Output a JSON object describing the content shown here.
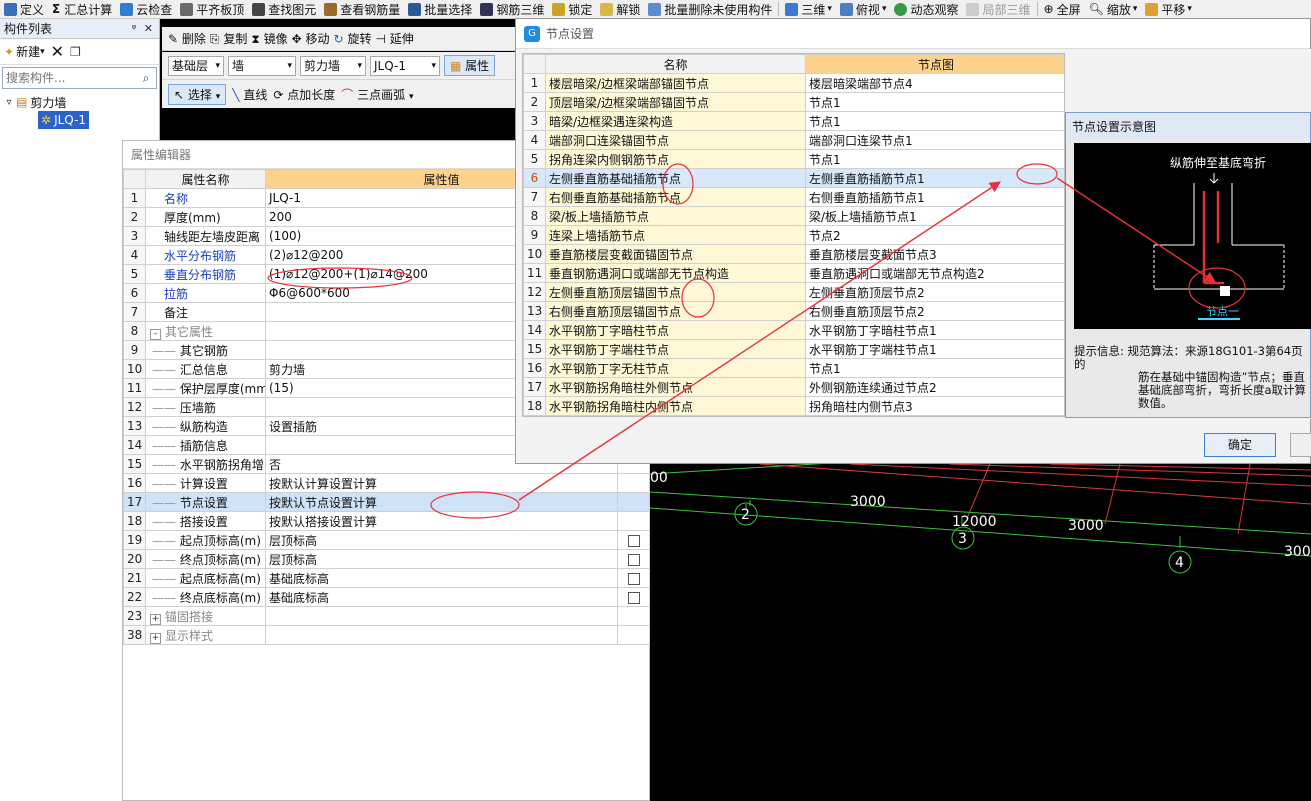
{
  "toolbar_top": {
    "items": [
      "定义",
      "汇总计算",
      "云检查",
      "平齐板顶",
      "查找图元",
      "查看钢筋量",
      "批量选择",
      "钢筋三维",
      "锁定",
      "解锁",
      "批量删除未使用构件",
      "三维",
      "俯视",
      "动态观察",
      "局部三维",
      "全屏",
      "缩放",
      "平移"
    ]
  },
  "left_panel": {
    "title": "构件列表",
    "new_label": "新建",
    "search_placeholder": "搜索构件...",
    "tree_root": "剪力墙",
    "tree_child": "JLQ-1"
  },
  "edit_toolbar": {
    "delete": "删除",
    "copy": "复制",
    "mirror": "镜像",
    "move": "移动",
    "rotate": "旋转",
    "extend": "延伸"
  },
  "filter_bar": {
    "layer": "基础层",
    "type": "墙",
    "subtype": "剪力墙",
    "component": "JLQ-1",
    "property_btn": "属性"
  },
  "draw_bar": {
    "select": "选择",
    "line": "直线",
    "point_length": "点加长度",
    "arc": "三点画弧"
  },
  "property_editor": {
    "title": "属性编辑器",
    "col_name": "属性名称",
    "col_value": "属性值",
    "rows": [
      {
        "n": "1",
        "name": "名称",
        "value": "JLQ-1",
        "blue": true
      },
      {
        "n": "2",
        "name": "厚度(mm)",
        "value": "200"
      },
      {
        "n": "3",
        "name": "轴线距左墙皮距离",
        "value": "(100)"
      },
      {
        "n": "4",
        "name": "水平分布钢筋",
        "value": "(2)⌀12@200",
        "blue": true
      },
      {
        "n": "5",
        "name": "垂直分布钢筋",
        "value": "(1)⌀12@200+(1)⌀14@200",
        "blue": true
      },
      {
        "n": "6",
        "name": "拉筋",
        "value": "Φ6@600*600",
        "blue": true
      },
      {
        "n": "7",
        "name": "备注",
        "value": ""
      },
      {
        "n": "8",
        "name": "其它属性",
        "value": "",
        "group": "-"
      },
      {
        "n": "9",
        "name": "其它钢筋",
        "value": "",
        "child": true
      },
      {
        "n": "10",
        "name": "汇总信息",
        "value": "剪力墙",
        "child": true
      },
      {
        "n": "11",
        "name": "保护层厚度(mm)",
        "value": "(15)",
        "child": true
      },
      {
        "n": "12",
        "name": "压墙筋",
        "value": "",
        "child": true
      },
      {
        "n": "13",
        "name": "纵筋构造",
        "value": "设置插筋",
        "child": true
      },
      {
        "n": "14",
        "name": "插筋信息",
        "value": "",
        "child": true
      },
      {
        "n": "15",
        "name": "水平钢筋拐角增",
        "value": "否",
        "child": true
      },
      {
        "n": "16",
        "name": "计算设置",
        "value": "按默认计算设置计算",
        "child": true
      },
      {
        "n": "17",
        "name": "节点设置",
        "value": "按默认节点设置计算",
        "child": true,
        "selected": true
      },
      {
        "n": "18",
        "name": "搭接设置",
        "value": "按默认搭接设置计算",
        "child": true
      },
      {
        "n": "19",
        "name": "起点顶标高(m)",
        "value": "层顶标高",
        "child": true,
        "check": true
      },
      {
        "n": "20",
        "name": "终点顶标高(m)",
        "value": "层顶标高",
        "child": true,
        "check": true
      },
      {
        "n": "21",
        "name": "起点底标高(m)",
        "value": "基础底标高",
        "child": true,
        "check": true
      },
      {
        "n": "22",
        "name": "终点底标高(m)",
        "value": "基础底标高",
        "child": true,
        "check": true
      },
      {
        "n": "23",
        "name": "锚固搭接",
        "value": "",
        "group": "+"
      },
      {
        "n": "38",
        "name": "显示样式",
        "value": "",
        "group": "+"
      }
    ]
  },
  "node_dialog": {
    "title": "节点设置",
    "col_name": "名称",
    "col_diagram": "节点图",
    "confirm": "确定",
    "rows": [
      {
        "n": "1",
        "name": "楼层暗梁/边框梁端部锚固节点",
        "node": "楼层暗梁端部节点4"
      },
      {
        "n": "2",
        "name": "顶层暗梁/边框梁端部锚固节点",
        "node": "节点1"
      },
      {
        "n": "3",
        "name": "暗梁/边框梁遇连梁构造",
        "node": "节点1"
      },
      {
        "n": "4",
        "name": "端部洞口连梁锚固节点",
        "node": "端部洞口连梁节点1"
      },
      {
        "n": "5",
        "name": "拐角连梁内侧钢筋节点",
        "node": "节点1"
      },
      {
        "n": "6",
        "name": "左侧垂直筋基础插筋节点",
        "node": "左侧垂直筋插筋节点1",
        "selected": true
      },
      {
        "n": "7",
        "name": "右侧垂直筋基础插筋节点",
        "node": "右侧垂直筋插筋节点1"
      },
      {
        "n": "8",
        "name": "梁/板上墙插筋节点",
        "node": "梁/板上墙插筋节点1"
      },
      {
        "n": "9",
        "name": "连梁上墙插筋节点",
        "node": "节点2"
      },
      {
        "n": "10",
        "name": "垂直筋楼层变截面锚固节点",
        "node": "垂直筋楼层变截面节点3"
      },
      {
        "n": "11",
        "name": "垂直钢筋遇洞口或端部无节点构造",
        "node": "垂直筋遇洞口或端部无节点构造2"
      },
      {
        "n": "12",
        "name": "左侧垂直筋顶层锚固节点",
        "node": "左侧垂直筋顶层节点2"
      },
      {
        "n": "13",
        "name": "右侧垂直筋顶层锚固节点",
        "node": "右侧垂直筋顶层节点2"
      },
      {
        "n": "14",
        "name": "水平钢筋丁字暗柱节点",
        "node": "水平钢筋丁字暗柱节点1"
      },
      {
        "n": "15",
        "name": "水平钢筋丁字端柱节点",
        "node": "水平钢筋丁字端柱节点1"
      },
      {
        "n": "16",
        "name": "水平钢筋丁字无柱节点",
        "node": "节点1"
      },
      {
        "n": "17",
        "name": "水平钢筋拐角暗柱外侧节点",
        "node": "外侧钢筋连续通过节点2"
      },
      {
        "n": "18",
        "name": "水平钢筋拐角暗柱内侧节点",
        "node": "拐角暗柱内侧节点3"
      }
    ]
  },
  "diagram_window": {
    "title": "节点设置示意图",
    "caption": "纵筋伸至基底弯折",
    "node_label": "节点一",
    "hint_label": "提示信息:",
    "hint_text": "规范算法：来源18G101-3第64页的",
    "hint_line2": "筋在基础中锚固构造”节点；垂直",
    "hint_line3": "基础底部弯折，弯折长度a取计算",
    "hint_line4": "数值。"
  },
  "cad": {
    "dims": [
      "3000",
      "12000",
      "3000",
      "300",
      "00"
    ],
    "axes": [
      "2",
      "3",
      "4"
    ]
  },
  "colors": {
    "accent": "#fbd38c",
    "selected": "#cfe2f7",
    "annotation": "#e8313a",
    "grid_green": "#3fbf3f",
    "grid_red": "#d83a3a"
  }
}
